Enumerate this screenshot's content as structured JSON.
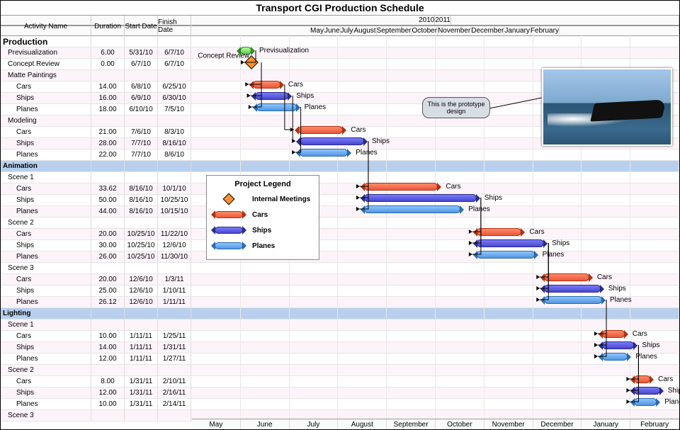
{
  "title": "Transport CGI Production Schedule",
  "headers": {
    "name": "Activity Name",
    "duration": "Duration",
    "start": "Start Date",
    "finish": "Finish Date"
  },
  "years": [
    "2010",
    "2011"
  ],
  "months": [
    "May",
    "June",
    "July",
    "August",
    "September",
    "October",
    "November",
    "December",
    "January",
    "February"
  ],
  "callout": "This is the prototype design",
  "legend": {
    "title": "Project Legend",
    "items": [
      {
        "label": "Internal Meetings",
        "type": "diamond"
      },
      {
        "label": "Cars",
        "type": "cars"
      },
      {
        "label": "Ships",
        "type": "ships"
      },
      {
        "label": "Planes",
        "type": "planes"
      }
    ]
  },
  "rows": [
    {
      "name": "Production",
      "dur": "",
      "sd": "",
      "ed": "",
      "cls": "section"
    },
    {
      "name": "Previsualization",
      "dur": "6.00",
      "sd": "5/31/10",
      "ed": "6/7/10",
      "indent": 1
    },
    {
      "name": "Concept Review",
      "dur": "0.00",
      "sd": "6/7/10",
      "ed": "6/7/10",
      "indent": 1
    },
    {
      "name": "Matte Paintings",
      "dur": "",
      "sd": "",
      "ed": "",
      "indent": 1
    },
    {
      "name": "Cars",
      "dur": "14.00",
      "sd": "6/8/10",
      "ed": "6/25/10",
      "indent": 2
    },
    {
      "name": "Ships",
      "dur": "16.00",
      "sd": "6/9/10",
      "ed": "6/30/10",
      "indent": 2
    },
    {
      "name": "Planes",
      "dur": "18.00",
      "sd": "6/10/10",
      "ed": "7/5/10",
      "indent": 2
    },
    {
      "name": "Modeling",
      "dur": "",
      "sd": "",
      "ed": "",
      "indent": 1
    },
    {
      "name": "Cars",
      "dur": "21.00",
      "sd": "7/6/10",
      "ed": "8/3/10",
      "indent": 2
    },
    {
      "name": "Ships",
      "dur": "28.00",
      "sd": "7/7/10",
      "ed": "8/16/10",
      "indent": 2
    },
    {
      "name": "Planes",
      "dur": "22.00",
      "sd": "7/7/10",
      "ed": "8/6/10",
      "indent": 2
    },
    {
      "name": "Animation",
      "dur": "",
      "sd": "",
      "ed": "",
      "cls": "band"
    },
    {
      "name": "Scene 1",
      "dur": "",
      "sd": "",
      "ed": "",
      "indent": 1
    },
    {
      "name": "Cars",
      "dur": "33.62",
      "sd": "8/16/10",
      "ed": "10/1/10",
      "indent": 2
    },
    {
      "name": "Ships",
      "dur": "50.00",
      "sd": "8/16/10",
      "ed": "10/25/10",
      "indent": 2
    },
    {
      "name": "Planes",
      "dur": "44.00",
      "sd": "8/16/10",
      "ed": "10/15/10",
      "indent": 2
    },
    {
      "name": "Scene 2",
      "dur": "",
      "sd": "",
      "ed": "",
      "indent": 1
    },
    {
      "name": "Cars",
      "dur": "20.00",
      "sd": "10/25/10",
      "ed": "11/22/10",
      "indent": 2
    },
    {
      "name": "Ships",
      "dur": "30.00",
      "sd": "10/25/10",
      "ed": "12/6/10",
      "indent": 2
    },
    {
      "name": "Planes",
      "dur": "26.00",
      "sd": "10/25/10",
      "ed": "11/30/10",
      "indent": 2
    },
    {
      "name": "Scene 3",
      "dur": "",
      "sd": "",
      "ed": "",
      "indent": 1
    },
    {
      "name": "Cars",
      "dur": "20.00",
      "sd": "12/6/10",
      "ed": "1/3/11",
      "indent": 2
    },
    {
      "name": "Ships",
      "dur": "25.00",
      "sd": "12/6/10",
      "ed": "1/10/11",
      "indent": 2
    },
    {
      "name": "Planes",
      "dur": "26.12",
      "sd": "12/6/10",
      "ed": "1/11/11",
      "indent": 2
    },
    {
      "name": "Lighting",
      "dur": "",
      "sd": "",
      "ed": "",
      "cls": "band"
    },
    {
      "name": "Scene 1",
      "dur": "",
      "sd": "",
      "ed": "",
      "indent": 1
    },
    {
      "name": "Cars",
      "dur": "10.00",
      "sd": "1/11/11",
      "ed": "1/25/11",
      "indent": 2
    },
    {
      "name": "Ships",
      "dur": "14.00",
      "sd": "1/11/11",
      "ed": "1/31/11",
      "indent": 2
    },
    {
      "name": "Planes",
      "dur": "12.00",
      "sd": "1/11/11",
      "ed": "1/27/11",
      "indent": 2
    },
    {
      "name": "Scene 2",
      "dur": "",
      "sd": "",
      "ed": "",
      "indent": 1
    },
    {
      "name": "Cars",
      "dur": "8.00",
      "sd": "1/31/11",
      "ed": "2/10/11",
      "indent": 2
    },
    {
      "name": "Ships",
      "dur": "12.00",
      "sd": "1/31/11",
      "ed": "2/16/11",
      "indent": 2
    },
    {
      "name": "Planes",
      "dur": "10.00",
      "sd": "1/31/11",
      "ed": "2/14/11",
      "indent": 2
    },
    {
      "name": "Scene 3",
      "dur": "",
      "sd": "",
      "ed": "",
      "indent": 1
    }
  ],
  "chart_data": {
    "type": "gantt",
    "x_axis": {
      "start": "2010-05-01",
      "end": "2011-02-28",
      "unit": "month"
    },
    "milestones": [
      {
        "name": "Concept Review",
        "date": "2010-06-07",
        "row": 2
      }
    ],
    "bars": [
      {
        "row": 1,
        "label": "Previsualization",
        "type": "green",
        "start": "2010-05-31",
        "end": "2010-06-07"
      },
      {
        "row": 4,
        "label": "Cars",
        "type": "cars",
        "start": "2010-06-08",
        "end": "2010-06-25"
      },
      {
        "row": 5,
        "label": "Ships",
        "type": "ships",
        "start": "2010-06-09",
        "end": "2010-06-30"
      },
      {
        "row": 6,
        "label": "Planes",
        "type": "planes",
        "start": "2010-06-10",
        "end": "2010-07-05"
      },
      {
        "row": 8,
        "label": "Cars",
        "type": "cars",
        "start": "2010-07-06",
        "end": "2010-08-03"
      },
      {
        "row": 9,
        "label": "Ships",
        "type": "ships",
        "start": "2010-07-07",
        "end": "2010-08-16"
      },
      {
        "row": 10,
        "label": "Planes",
        "type": "planes",
        "start": "2010-07-07",
        "end": "2010-08-06"
      },
      {
        "row": 13,
        "label": "Cars",
        "type": "cars",
        "start": "2010-08-16",
        "end": "2010-10-01"
      },
      {
        "row": 14,
        "label": "Ships",
        "type": "ships",
        "start": "2010-08-16",
        "end": "2010-10-25"
      },
      {
        "row": 15,
        "label": "Planes",
        "type": "planes",
        "start": "2010-08-16",
        "end": "2010-10-15"
      },
      {
        "row": 17,
        "label": "Cars",
        "type": "cars",
        "start": "2010-10-25",
        "end": "2010-11-22"
      },
      {
        "row": 18,
        "label": "Ships",
        "type": "ships",
        "start": "2010-10-25",
        "end": "2010-12-06"
      },
      {
        "row": 19,
        "label": "Planes",
        "type": "planes",
        "start": "2010-10-25",
        "end": "2010-11-30"
      },
      {
        "row": 21,
        "label": "Cars",
        "type": "cars",
        "start": "2010-12-06",
        "end": "2011-01-03"
      },
      {
        "row": 22,
        "label": "Ships",
        "type": "ships",
        "start": "2010-12-06",
        "end": "2011-01-10"
      },
      {
        "row": 23,
        "label": "Planes",
        "type": "planes",
        "start": "2010-12-06",
        "end": "2011-01-11"
      },
      {
        "row": 26,
        "label": "Cars",
        "type": "cars",
        "start": "2011-01-11",
        "end": "2011-01-25"
      },
      {
        "row": 27,
        "label": "Ships",
        "type": "ships",
        "start": "2011-01-11",
        "end": "2011-01-31"
      },
      {
        "row": 28,
        "label": "Planes",
        "type": "planes",
        "start": "2011-01-11",
        "end": "2011-01-27"
      },
      {
        "row": 30,
        "label": "Cars",
        "type": "cars",
        "start": "2011-01-31",
        "end": "2011-02-10"
      },
      {
        "row": 31,
        "label": "Ships",
        "type": "ships",
        "start": "2011-01-31",
        "end": "2011-02-16"
      },
      {
        "row": 32,
        "label": "Planes",
        "type": "planes",
        "start": "2011-01-31",
        "end": "2011-02-14"
      }
    ],
    "dependencies": [
      [
        1,
        2
      ],
      [
        2,
        4
      ],
      [
        2,
        5
      ],
      [
        2,
        6
      ],
      [
        4,
        8
      ],
      [
        5,
        9
      ],
      [
        6,
        10
      ],
      [
        9,
        13
      ],
      [
        9,
        14
      ],
      [
        9,
        15
      ],
      [
        14,
        17
      ],
      [
        14,
        18
      ],
      [
        14,
        19
      ],
      [
        18,
        21
      ],
      [
        18,
        22
      ],
      [
        18,
        23
      ],
      [
        23,
        26
      ],
      [
        23,
        27
      ],
      [
        23,
        28
      ],
      [
        27,
        30
      ],
      [
        27,
        31
      ],
      [
        27,
        32
      ]
    ]
  }
}
